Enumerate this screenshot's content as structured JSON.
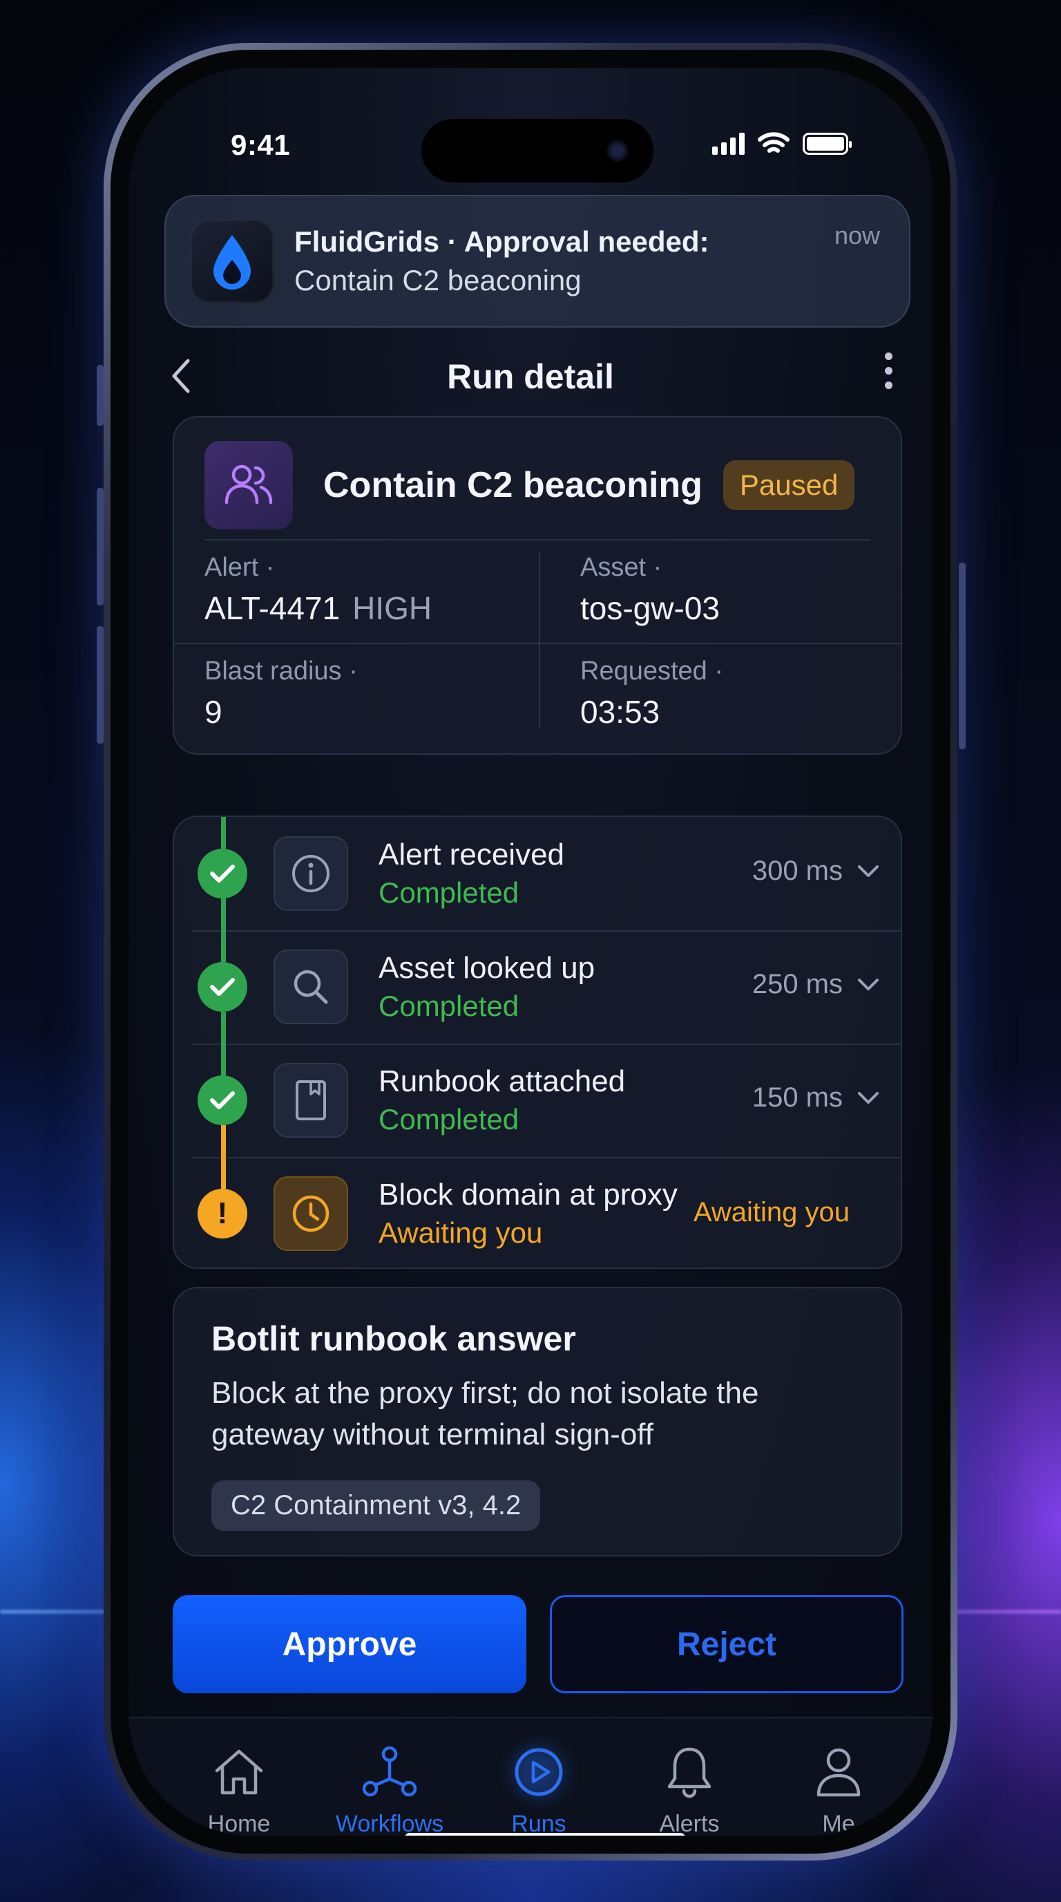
{
  "status_bar": {
    "time": "9:41"
  },
  "notification": {
    "title": "FluidGrids · Approval needed:",
    "body": "Contain C2 beaconing",
    "time": "now"
  },
  "nav": {
    "title": "Run detail"
  },
  "run": {
    "title": "Contain C2 beaconing",
    "status": "Paused",
    "fields": {
      "alert_label": "Alert ·",
      "alert_value": "ALT-4471",
      "alert_severity": "HIGH",
      "asset_label": "Asset ·",
      "asset_value": "tos-gw-03",
      "blast_label": "Blast radius ·",
      "blast_value": "9",
      "requested_label": "Requested ·",
      "requested_value": "03:53"
    }
  },
  "steps": [
    {
      "name": "Alert received",
      "status": "Completed",
      "duration": "300 ms",
      "icon": "info-icon"
    },
    {
      "name": "Asset looked up",
      "status": "Completed",
      "duration": "250 ms",
      "icon": "search-icon"
    },
    {
      "name": "Runbook attached",
      "status": "Completed",
      "duration": "150 ms",
      "icon": "book-icon"
    },
    {
      "name": "Block domain at proxy",
      "status": "Awaiting you",
      "duration": "Awaiting you",
      "icon": "clock-icon"
    }
  ],
  "runbook": {
    "title": "Botlit runbook answer",
    "body": "Block at the proxy first; do not isolate the gateway without terminal sign-off",
    "citation": "C2 Containment v3, 4.2"
  },
  "actions": {
    "approve": "Approve",
    "reject": "Reject"
  },
  "tabs": [
    {
      "label": "Home",
      "icon": "home-icon"
    },
    {
      "label": "Workflows",
      "icon": "workflow-icon"
    },
    {
      "label": "Runs",
      "icon": "play-icon"
    },
    {
      "label": "Alerts",
      "icon": "bell-icon"
    },
    {
      "label": "Me",
      "icon": "person-icon"
    }
  ],
  "colors": {
    "accent": "#2b6ff2",
    "success": "#3fb950",
    "warning": "#f5a623",
    "paused_badge": "#f4b548"
  }
}
